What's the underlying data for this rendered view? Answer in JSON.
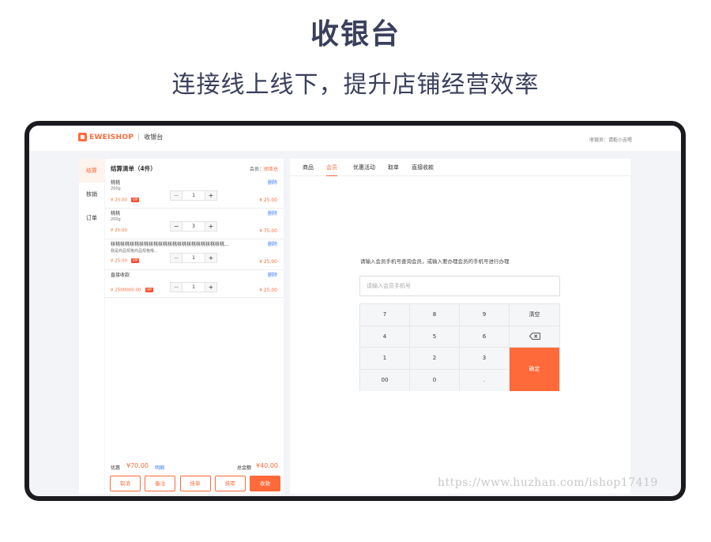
{
  "hero": {
    "title": "收银台",
    "subtitle": "连接线上线下，提升店铺经营效率"
  },
  "topbar": {
    "brand": "EWEISHOP",
    "app_name": "收银台",
    "cashier": "收银员：请乾小吉嗯"
  },
  "sidenav": {
    "items": [
      {
        "label": "结算",
        "active": true
      },
      {
        "label": "核销",
        "active": false
      },
      {
        "label": "订单",
        "active": false
      }
    ]
  },
  "order": {
    "title": "结算清单（4件）",
    "member_prefix": "会员：",
    "member_name": "胡亚总",
    "delete_label": "删除",
    "items": [
      {
        "name": "桃桃",
        "spec": "200g",
        "price": "¥ 25.00",
        "vip": "VIP",
        "qty": "1",
        "total": "¥ 25.00"
      },
      {
        "name": "桃桃",
        "spec": "200g",
        "price": "¥ 25.00",
        "vip": "",
        "qty": "3",
        "total": "¥ 75.00"
      },
      {
        "name": "核桃核桃核桃核桃核桃核桃核桃核桃核桃核桃核桃核桃...",
        "spec": "我是商品规格商品规格哦...",
        "price": "¥ 25.00",
        "vip": "VIP",
        "qty": "1",
        "total": "¥ 25.00"
      },
      {
        "name": "直接收款",
        "spec": "",
        "price": "¥ 2500000.00",
        "vip": "VIP",
        "qty": "1",
        "total": "¥ 25.00"
      }
    ],
    "discount_label": "优惠",
    "discount_value": "¥70.00",
    "discount_detail": "明细",
    "total_label": "总金额",
    "total_value": "¥40.00",
    "actions": [
      "取消",
      "备注",
      "挂单",
      "抹零",
      "收款"
    ]
  },
  "right": {
    "tabs": [
      "商品",
      "会员",
      "优惠活动",
      "取单",
      "直接收款"
    ],
    "active_tab": "会员",
    "hint": "请输入会员手机号查询会员，或输入要办理会员的手机号进行办理",
    "phone_placeholder": "请输入会员手机号",
    "keys": {
      "k7": "7",
      "k8": "8",
      "k9": "9",
      "clear": "清空",
      "k4": "4",
      "k5": "5",
      "k6": "6",
      "k1": "1",
      "k2": "2",
      "k3": "3",
      "confirm": "确定",
      "k00": "00",
      "k0": "0",
      "dot": "."
    }
  },
  "watermark": "https://www.huzhan.com/ishop17419",
  "colors": {
    "accent": "#ff6a3a",
    "link": "#3d7ef5",
    "title": "#3a3f5c"
  }
}
